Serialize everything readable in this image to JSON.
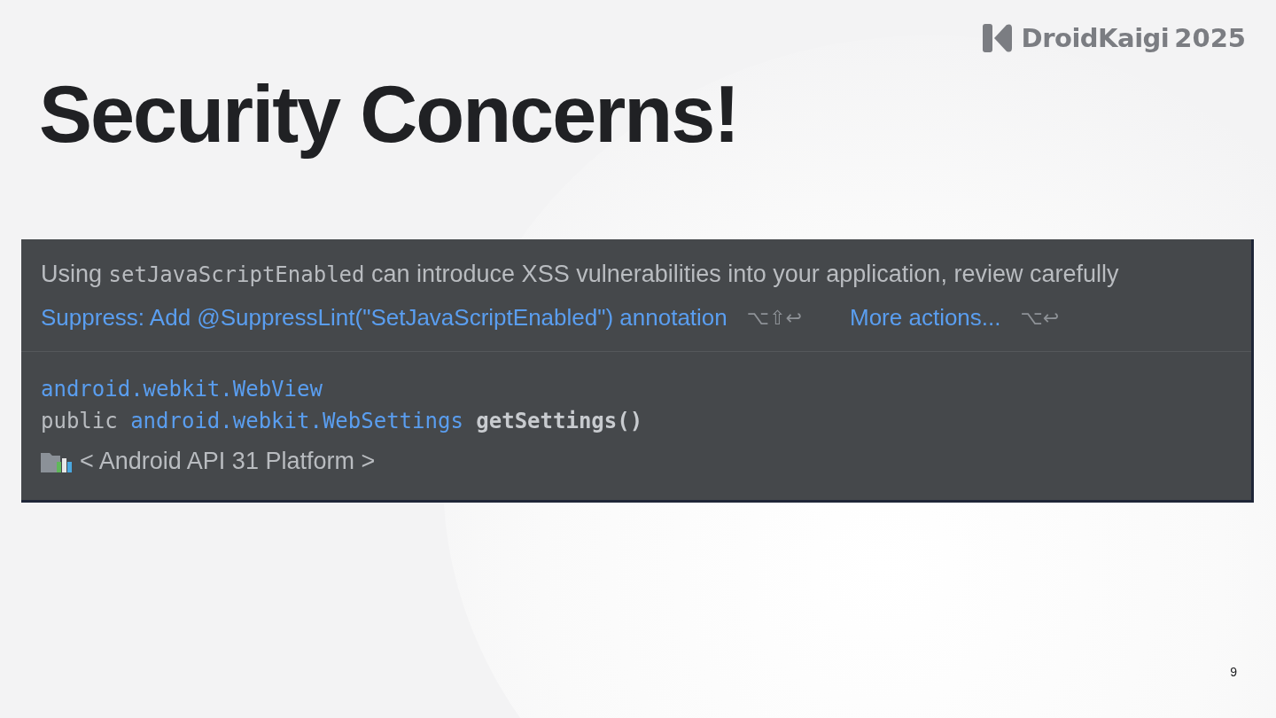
{
  "logo": {
    "name": "DroidKaigi",
    "year": "2025"
  },
  "title": "Security Concerns!",
  "popup": {
    "message": [
      {
        "kind": "text",
        "text": "Using "
      },
      {
        "kind": "code",
        "text": "setJavaScriptEnabled"
      },
      {
        "kind": "text",
        "text": " can introduce XSS vulnerabilities into your application, review carefully"
      }
    ],
    "actions": [
      {
        "label": "Suppress: Add @SuppressLint(\"SetJavaScriptEnabled\") annotation",
        "shortcut": "⌥⇧↩"
      },
      {
        "label": "More actions...",
        "shortcut": "⌥↩"
      }
    ],
    "doc_lines": [
      [
        {
          "kind": "link",
          "text": "android.webkit.WebView"
        }
      ],
      [
        {
          "kind": "plain",
          "text": "public "
        },
        {
          "kind": "link",
          "text": "android.webkit.WebSettings"
        },
        {
          "kind": "bold",
          "text": " getSettings()"
        }
      ]
    ],
    "library": "< Android API 31 Platform >"
  },
  "page_number": "9"
}
